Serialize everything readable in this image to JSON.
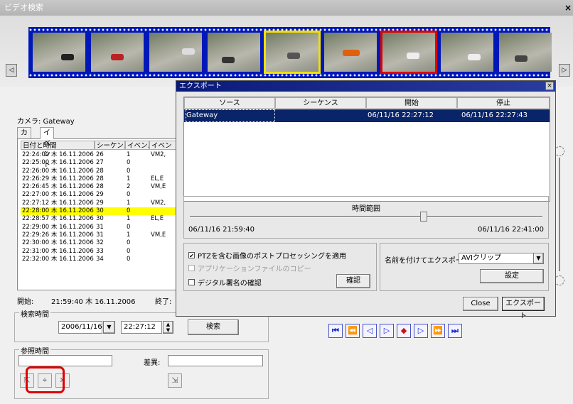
{
  "window": {
    "title": "ビデオ検索",
    "close": "×"
  },
  "filmstrip": {
    "prev": "◁",
    "next": "▷"
  },
  "camera_label": "カメラ: Gateway",
  "tabs": {
    "camera": "カメラ",
    "event": "イベント"
  },
  "event_table": {
    "headers": [
      "日付と時間",
      "シーケンス",
      "イベン...",
      "イベン"
    ],
    "rows": [
      [
        "22:24:00 木 16.11.2006",
        "26",
        "1",
        "VM2,"
      ],
      [
        "22:25:00 木 16.11.2006",
        "27",
        "0",
        ""
      ],
      [
        "22:26:00 木 16.11.2006",
        "28",
        "0",
        ""
      ],
      [
        "22:26:29 木 16.11.2006",
        "28",
        "1",
        "EL,E"
      ],
      [
        "22:26:45 木 16.11.2006",
        "28",
        "2",
        "VM,E"
      ],
      [
        "22:27:00 木 16.11.2006",
        "29",
        "0",
        ""
      ],
      [
        "22:27:12 木 16.11.2006",
        "29",
        "1",
        "VM2,"
      ],
      [
        "22:28:00 木 16.11.2006",
        "30",
        "0",
        ""
      ],
      [
        "22:28:57 木 16.11.2006",
        "30",
        "1",
        "EL,E"
      ],
      [
        "22:29:00 木 16.11.2006",
        "31",
        "0",
        ""
      ],
      [
        "22:29:26 木 16.11.2006",
        "31",
        "1",
        "VM,E"
      ],
      [
        "22:30:00 木 16.11.2006",
        "32",
        "0",
        ""
      ],
      [
        "22:31:00 木 16.11.2006",
        "33",
        "0",
        ""
      ],
      [
        "22:32:00 木 16.11.2006",
        "34",
        "0",
        ""
      ]
    ],
    "selected_index": 7
  },
  "start": {
    "label": "開始:",
    "value": "21:59:40 木 16.11.2006"
  },
  "end": {
    "label": "終了:"
  },
  "search_time": {
    "title": "検索時間",
    "date": "2006/11/16",
    "time": "22:27:12",
    "search_button": "検索"
  },
  "reference_time": {
    "title": "参照時間",
    "diff_label": "差異:"
  },
  "playback": [
    "first-frame",
    "rewind",
    "step-back",
    "play",
    "stop",
    "step-forward",
    "fast-forward",
    "last-frame"
  ],
  "export_dialog": {
    "title": "エクスポート",
    "close": "×",
    "columns": [
      "ソース",
      "シーケンス",
      "開始",
      "停止"
    ],
    "rows": [
      {
        "source": "Gateway",
        "sequence": "",
        "start": "06/11/16 22:27:12",
        "stop": "06/11/16 22:27:43"
      }
    ],
    "time_range": {
      "title": "時間範囲",
      "from": "06/11/16 21:59:40",
      "to": "06/11/16 22:41:00"
    },
    "options": {
      "ptz": {
        "label": "PTZを含む画像のポストプロセッシングを適用",
        "checked": true
      },
      "app_copy": {
        "label": "アプリケーションファイルのコピー",
        "checked": false,
        "disabled": true
      },
      "signature": {
        "label": "デジタル署名の確認",
        "checked": false
      }
    },
    "confirm_button": "確認",
    "export_as": {
      "label": "名前を付けてエクスポート:",
      "value": "AVIクリップ"
    },
    "settings_button": "設定",
    "close_button": "Close",
    "export_button": "エクスポート"
  },
  "colors": {
    "selection": "#0a246a",
    "highlight_row": "#ffff00",
    "film_blue": "#0018b8",
    "annotation_red": "#e00000"
  }
}
